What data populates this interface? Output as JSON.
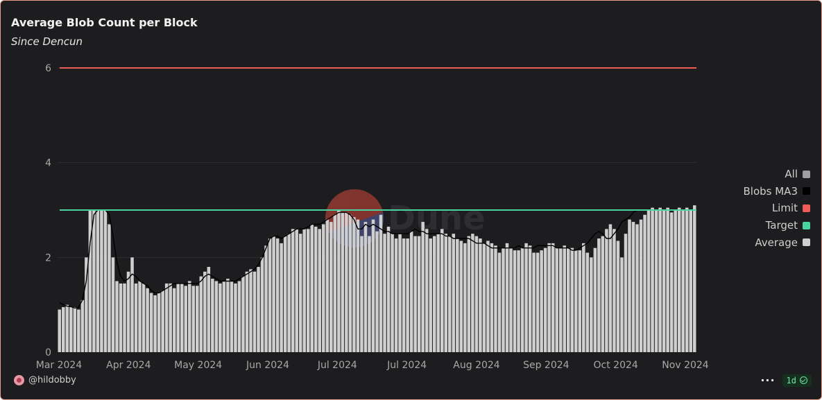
{
  "header": {
    "title": "Average Blob Count per Block",
    "subtitle": "Since Dencun"
  },
  "footer": {
    "author": "@hildobby",
    "more_label": "···",
    "refresh_label": "1d"
  },
  "watermark": {
    "text": "Dune"
  },
  "legend": [
    {
      "label": "All",
      "color": "#9e9ea3"
    },
    {
      "label": "Blobs MA3",
      "color": "#000000"
    },
    {
      "label": "Limit",
      "color": "#ef5b57"
    },
    {
      "label": "Target",
      "color": "#48d3a0"
    },
    {
      "label": "Average",
      "color": "#cfcfcf"
    }
  ],
  "chart_data": {
    "type": "bar",
    "grid": "horizontal",
    "legend_position": "right",
    "x": {
      "start": "2024-03-14",
      "end": "2024-11-03",
      "ticks": [
        {
          "date": "2024-03-01",
          "label": "Mar 2024"
        },
        {
          "date": "2024-04-01",
          "label": "Apr 2024"
        },
        {
          "date": "2024-05-01",
          "label": "May 2024"
        },
        {
          "date": "2024-06-01",
          "label": "Jun 2024"
        },
        {
          "date": "2024-07-01",
          "label": "Jul 2024"
        },
        {
          "date": "2024-08-01",
          "label": "Jul 2024"
        },
        {
          "date": "2024-09-01",
          "label": "Aug 2024"
        },
        {
          "date": "2024-10-01",
          "label": "Sep 2024"
        },
        {
          "date": "2024-11-01",
          "label": "Oct 2024"
        },
        {
          "date": "2024-12-01",
          "label": "Nov 2024"
        }
      ]
    },
    "y": {
      "ylim": [
        0,
        6
      ],
      "ticks": [
        0,
        2,
        4,
        6
      ]
    },
    "series": [
      {
        "name": "Average",
        "kind": "bar",
        "color": "#cfcfcf",
        "values": [
          0.9,
          0.95,
          1.0,
          0.95,
          0.95,
          0.9,
          1.1,
          2.0,
          3.0,
          3.0,
          3.0,
          3.0,
          3.0,
          2.7,
          2.0,
          1.5,
          1.45,
          1.45,
          1.7,
          2.0,
          1.45,
          1.5,
          1.45,
          1.35,
          1.25,
          1.2,
          1.25,
          1.3,
          1.45,
          1.45,
          1.35,
          1.45,
          1.45,
          1.4,
          1.5,
          1.4,
          1.4,
          1.6,
          1.7,
          1.8,
          1.55,
          1.5,
          1.45,
          1.5,
          1.55,
          1.5,
          1.45,
          1.5,
          1.6,
          1.7,
          1.75,
          1.7,
          1.8,
          2.0,
          2.25,
          2.4,
          2.45,
          2.4,
          2.3,
          2.45,
          2.5,
          2.6,
          2.6,
          2.5,
          2.6,
          2.6,
          2.7,
          2.65,
          2.6,
          2.7,
          2.8,
          2.75,
          2.9,
          3.0,
          2.95,
          2.95,
          2.9,
          2.85,
          2.8,
          2.45,
          2.75,
          2.45,
          2.8,
          2.55,
          2.9,
          2.5,
          2.65,
          2.5,
          2.4,
          2.5,
          2.4,
          2.4,
          2.55,
          2.45,
          2.45,
          2.75,
          2.6,
          2.4,
          2.45,
          2.5,
          2.6,
          2.5,
          2.45,
          2.5,
          2.4,
          2.35,
          2.3,
          2.45,
          2.5,
          2.45,
          2.4,
          2.3,
          2.35,
          2.3,
          2.25,
          2.1,
          2.2,
          2.3,
          2.2,
          2.15,
          2.15,
          2.2,
          2.3,
          2.25,
          2.1,
          2.1,
          2.15,
          2.2,
          2.3,
          2.3,
          2.2,
          2.2,
          2.25,
          2.2,
          2.2,
          2.15,
          2.15,
          2.3,
          2.1,
          2.0,
          2.2,
          2.4,
          2.45,
          2.6,
          2.7,
          2.6,
          2.35,
          2.0,
          2.5,
          2.8,
          2.75,
          2.7,
          2.8,
          2.9,
          3.0,
          3.05,
          3.0,
          3.05,
          3.0,
          3.05,
          2.95,
          3.0,
          3.05,
          3.0,
          3.05,
          3.0,
          3.1
        ]
      },
      {
        "name": "All",
        "kind": "bar",
        "color": "#9e9ea3",
        "values": []
      },
      {
        "name": "Blobs MA3",
        "kind": "line",
        "color": "#000000",
        "values": [
          1.05,
          1.0,
          0.97,
          0.96,
          0.93,
          0.95,
          1.1,
          1.5,
          2.3,
          2.9,
          3.0,
          3.0,
          3.0,
          2.9,
          2.45,
          1.9,
          1.6,
          1.5,
          1.55,
          1.65,
          1.6,
          1.5,
          1.45,
          1.4,
          1.3,
          1.25,
          1.25,
          1.3,
          1.35,
          1.4,
          1.45,
          1.45,
          1.45,
          1.45,
          1.45,
          1.45,
          1.45,
          1.5,
          1.6,
          1.65,
          1.6,
          1.55,
          1.5,
          1.5,
          1.5,
          1.5,
          1.5,
          1.55,
          1.6,
          1.65,
          1.7,
          1.75,
          1.85,
          2.0,
          2.2,
          2.4,
          2.45,
          2.45,
          2.4,
          2.45,
          2.5,
          2.55,
          2.6,
          2.6,
          2.6,
          2.65,
          2.7,
          2.7,
          2.7,
          2.75,
          2.8,
          2.85,
          2.9,
          2.95,
          2.95,
          2.95,
          2.9,
          2.8,
          2.6,
          2.6,
          2.7,
          2.65,
          2.7,
          2.65,
          2.6,
          2.55,
          2.55,
          2.5,
          2.5,
          2.5,
          2.5,
          2.5,
          2.55,
          2.6,
          2.55,
          2.55,
          2.5,
          2.5,
          2.5,
          2.5,
          2.5,
          2.45,
          2.45,
          2.4,
          2.4,
          2.4,
          2.4,
          2.4,
          2.35,
          2.3,
          2.3,
          2.3,
          2.25,
          2.2,
          2.2,
          2.2,
          2.2,
          2.2,
          2.2,
          2.2,
          2.25,
          2.2,
          2.2,
          2.2,
          2.2,
          2.25,
          2.25,
          2.25,
          2.25,
          2.25,
          2.2,
          2.2,
          2.2,
          2.2,
          2.15,
          2.15,
          2.2,
          2.25,
          2.3,
          2.4,
          2.5,
          2.55,
          2.5,
          2.4,
          2.4,
          2.5,
          2.6,
          2.75,
          2.8,
          2.85,
          2.95,
          3.0,
          3.0,
          3.0,
          3.0,
          3.0,
          3.0,
          3.0,
          3.0,
          3.0,
          3.0,
          3.0,
          3.0,
          3.0,
          3.0
        ]
      },
      {
        "name": "Limit",
        "kind": "hline",
        "color": "#ef5b57",
        "value": 6
      },
      {
        "name": "Target",
        "kind": "hline",
        "color": "#48d3a0",
        "value": 3
      }
    ]
  }
}
